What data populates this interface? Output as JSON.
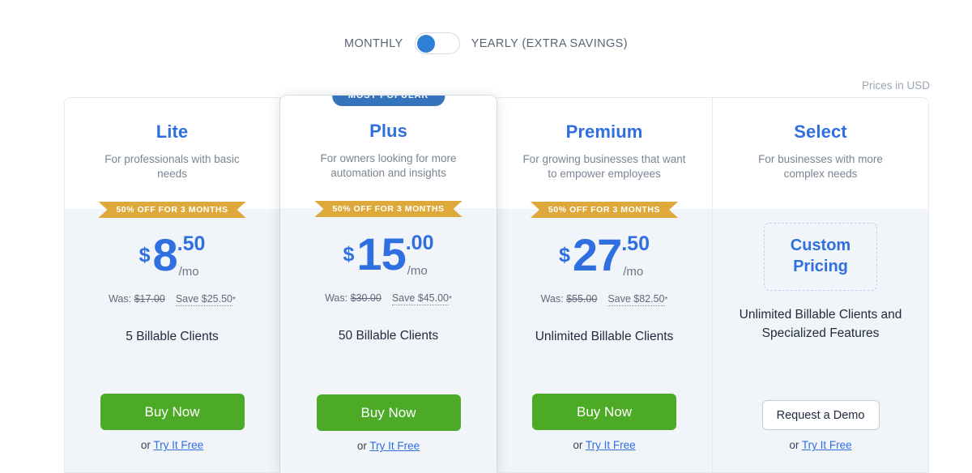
{
  "billing_toggle": {
    "monthly_label": "MONTHLY",
    "yearly_label": "YEARLY (EXTRA SAVINGS)",
    "selected": "MONTHLY",
    "accent_color": "#2f7fd6"
  },
  "prices_note": "Prices in USD",
  "featured_badge": "MOST POPULAR",
  "ribbon_text": "50% OFF FOR 3 MONTHS",
  "ribbon_color": "#dfa83a",
  "accent_blue": "#2f6fe0",
  "buy_button_color": "#4caa26",
  "plans": [
    {
      "name": "Lite",
      "description": "For professionals with basic needs",
      "ribbon": "50% OFF FOR 3 MONTHS",
      "currency": "$",
      "amount": "8",
      "cents": ".50",
      "period": "/mo",
      "was_label": "Was:",
      "was_value": "$17.00",
      "save_text": "Save $25.50",
      "save_asterisk": "*",
      "feature": "5 Billable Clients",
      "cta_label": "Buy Now",
      "or_text": "or ",
      "try_label": "Try It Free"
    },
    {
      "name": "Plus",
      "description": "For owners looking for more automation and insights",
      "ribbon": "50% OFF FOR 3 MONTHS",
      "currency": "$",
      "amount": "15",
      "cents": ".00",
      "period": "/mo",
      "was_label": "Was:",
      "was_value": "$30.00",
      "save_text": "Save $45.00",
      "save_asterisk": "*",
      "feature": "50 Billable Clients",
      "cta_label": "Buy Now",
      "or_text": "or ",
      "try_label": "Try It Free"
    },
    {
      "name": "Premium",
      "description": "For growing businesses that want to empower employees",
      "ribbon": "50% OFF FOR 3 MONTHS",
      "currency": "$",
      "amount": "27",
      "cents": ".50",
      "period": "/mo",
      "was_label": "Was:",
      "was_value": "$55.00",
      "save_text": "Save $82.50",
      "save_asterisk": "*",
      "feature": "Unlimited Billable Clients",
      "cta_label": "Buy Now",
      "or_text": "or ",
      "try_label": "Try It Free"
    },
    {
      "name": "Select",
      "description": "For businesses with more complex needs",
      "custom_pricing_line1": "Custom",
      "custom_pricing_line2": "Pricing",
      "feature": "Unlimited Billable Clients and Specialized Features",
      "cta_label": "Request a Demo",
      "or_text": "or ",
      "try_label": "Try It Free"
    }
  ]
}
